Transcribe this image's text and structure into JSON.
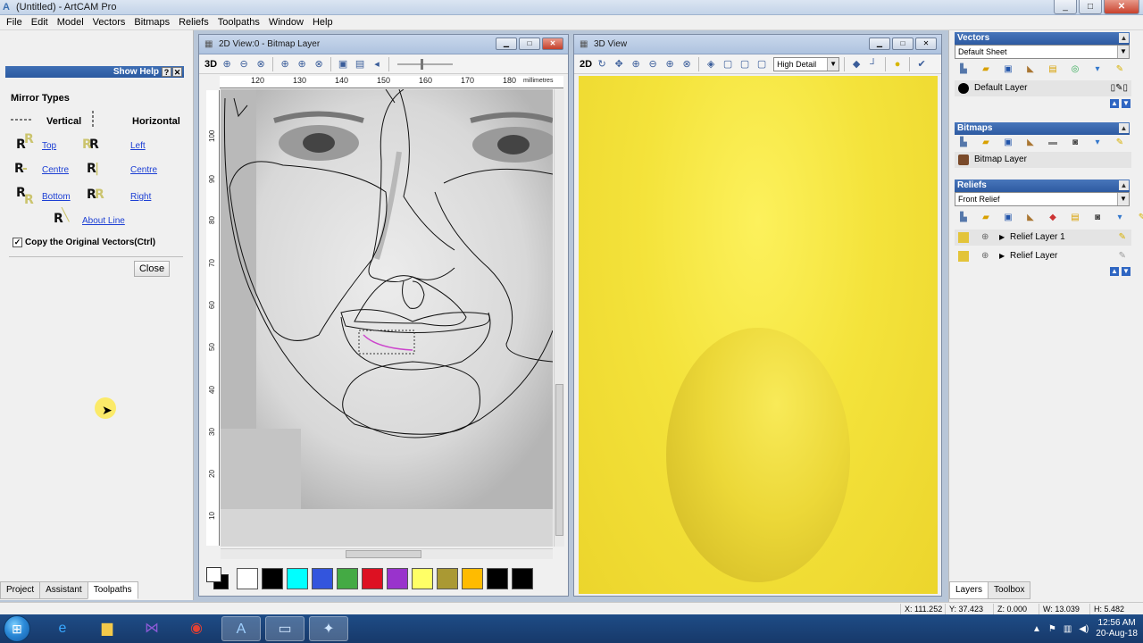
{
  "app": {
    "title": "(Untitled) - ArtCAM Pro",
    "logo_letter": "A",
    "window_buttons": [
      "_",
      "□",
      "✕"
    ]
  },
  "menu": [
    "File",
    "Edit",
    "Model",
    "Vectors",
    "Bitmaps",
    "Reliefs",
    "Toolpaths",
    "Window",
    "Help"
  ],
  "assistant": {
    "show_help": "Show Help",
    "help_q": "?",
    "help_x": "✕",
    "mirror_title": "Mirror Types",
    "vertical_label": "Vertical",
    "horizontal_label": "Horizontal",
    "links": {
      "top": "Top",
      "centre_v": "Centre",
      "bottom": "Bottom",
      "left": "Left",
      "centre_h": "Centre",
      "right": "Right",
      "about_line": "About Line"
    },
    "copy_check": "Copy the Original Vectors(Ctrl)",
    "copy_checked": "✓",
    "close_label": "Close",
    "tabs": [
      "Project",
      "Assistant",
      "Toolpaths"
    ]
  },
  "view2d": {
    "title": "2D View:0 - Bitmap Layer",
    "toolbar_3d": "3D",
    "ruler_top": [
      "120",
      "130",
      "140",
      "150",
      "160",
      "170",
      "180"
    ],
    "ruler_unit": "millimetres",
    "ruler_left": [
      "100",
      "90",
      "80",
      "70",
      "60",
      "50",
      "40",
      "30",
      "20",
      "10"
    ],
    "palette": [
      "#ffffff",
      "#000000",
      "#00ffff",
      "#3355dd",
      "#44aa44",
      "#dd1122",
      "#9933cc",
      "#ffff66",
      "#aa9933",
      "#ffbb00",
      "#000000",
      "#000000"
    ]
  },
  "view3d": {
    "title": "3D View",
    "toolbar_2d": "2D",
    "detail": "High Detail",
    "colors": {
      "bg": "#f4e33b",
      "blob": "#e9d536"
    }
  },
  "right": {
    "vectors": {
      "title": "Vectors",
      "sheet": "Default Sheet",
      "layer": "Default Layer"
    },
    "bitmaps": {
      "title": "Bitmaps",
      "layer": "Bitmap Layer"
    },
    "reliefs": {
      "title": "Reliefs",
      "relief": "Front Relief",
      "layers": [
        "Relief Layer 1",
        "Relief Layer"
      ]
    },
    "tabs": [
      "Layers",
      "Toolbox"
    ]
  },
  "status": {
    "x": "X: 111.252",
    "y": "Y: 37.423",
    "z": "Z: 0.000",
    "w": "W: 13.039",
    "h": "H: 5.482"
  },
  "taskbar": {
    "time": "12:56 AM",
    "date": "20-Aug-18"
  }
}
